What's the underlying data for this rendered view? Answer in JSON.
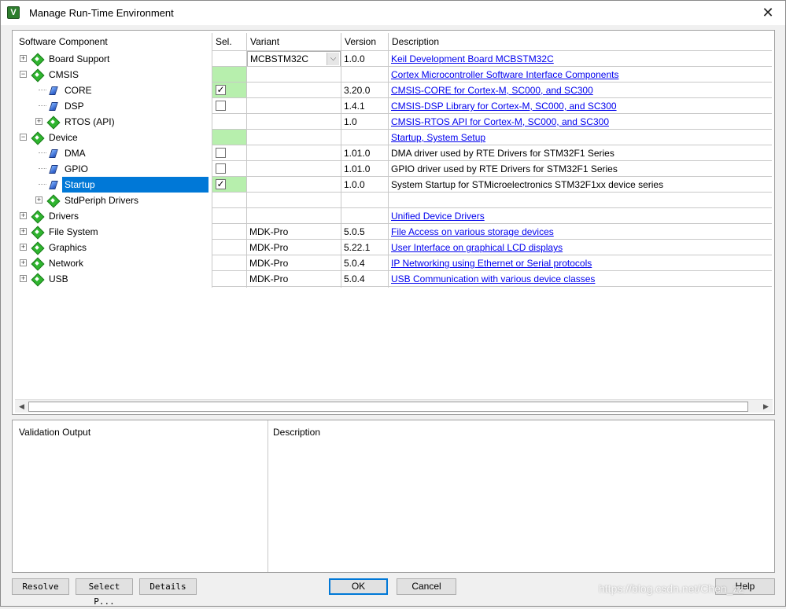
{
  "window": {
    "title": "Manage Run-Time Environment",
    "icon_letter": "V",
    "close_glyph": "✕"
  },
  "grid": {
    "headers": {
      "component": "Software Component",
      "sel": "Sel.",
      "variant": "Variant",
      "version": "Version",
      "description": "Description"
    },
    "rows": [
      {
        "name": "Board Support",
        "level": 0,
        "expander": "+",
        "icon": "component-icon",
        "sel": "",
        "sel_green": false,
        "checkbox": null,
        "variant": "MCBSTM32C",
        "variant_combo": true,
        "version": "1.0.0",
        "description": "Keil Development Board MCBSTM32C",
        "desc_link": true
      },
      {
        "name": "CMSIS",
        "level": 0,
        "expander": "−",
        "icon": "component-icon",
        "sel": "",
        "sel_green": true,
        "checkbox": null,
        "variant": "",
        "variant_combo": false,
        "version": "",
        "description": "Cortex Microcontroller Software Interface Components",
        "desc_link": true
      },
      {
        "name": "CORE",
        "level": 1,
        "expander": "",
        "icon": "gem-icon",
        "sel": "",
        "sel_green": true,
        "checkbox": true,
        "variant": "",
        "variant_combo": false,
        "version": "3.20.0",
        "description": "CMSIS-CORE for Cortex-M, SC000, and SC300",
        "desc_link": true
      },
      {
        "name": "DSP",
        "level": 1,
        "expander": "",
        "icon": "gem-icon",
        "sel": "",
        "sel_green": false,
        "checkbox": false,
        "variant": "",
        "variant_combo": false,
        "version": "1.4.1",
        "description": "CMSIS-DSP Library for Cortex-M, SC000, and SC300",
        "desc_link": true
      },
      {
        "name": "RTOS (API)",
        "level": 1,
        "expander": "+",
        "icon": "component-icon",
        "sel": "",
        "sel_green": false,
        "checkbox": null,
        "variant": "",
        "variant_combo": false,
        "version": "1.0",
        "description": "CMSIS-RTOS API for Cortex-M, SC000, and SC300",
        "desc_link": true
      },
      {
        "name": "Device",
        "level": 0,
        "expander": "−",
        "icon": "component-icon",
        "sel": "",
        "sel_green": true,
        "checkbox": null,
        "variant": "",
        "variant_combo": false,
        "version": "",
        "description": "Startup, System Setup",
        "desc_link": true
      },
      {
        "name": "DMA",
        "level": 1,
        "expander": "",
        "icon": "gem-icon",
        "sel": "",
        "sel_green": false,
        "checkbox": false,
        "variant": "",
        "variant_combo": false,
        "version": "1.01.0",
        "description": "DMA driver used by RTE Drivers for STM32F1 Series",
        "desc_link": false
      },
      {
        "name": "GPIO",
        "level": 1,
        "expander": "",
        "icon": "gem-icon",
        "sel": "",
        "sel_green": false,
        "checkbox": false,
        "variant": "",
        "variant_combo": false,
        "version": "1.01.0",
        "description": "GPIO driver used by RTE Drivers for STM32F1 Series",
        "desc_link": false
      },
      {
        "name": "Startup",
        "level": 1,
        "expander": "",
        "icon": "gem-icon",
        "sel": "",
        "sel_green": true,
        "checkbox": true,
        "variant": "",
        "variant_combo": false,
        "version": "1.0.0",
        "description": "System Startup for STMicroelectronics STM32F1xx device series",
        "desc_link": false,
        "selected": true
      },
      {
        "name": "StdPeriph Drivers",
        "level": 1,
        "expander": "+",
        "icon": "component-icon",
        "sel": "",
        "sel_green": false,
        "checkbox": null,
        "variant": "",
        "variant_combo": false,
        "version": "",
        "description": "",
        "desc_link": false
      },
      {
        "name": "Drivers",
        "level": 0,
        "expander": "+",
        "icon": "component-icon",
        "sel": "",
        "sel_green": false,
        "checkbox": null,
        "variant": "",
        "variant_combo": false,
        "version": "",
        "description": "Unified Device Drivers",
        "desc_link": true
      },
      {
        "name": "File System",
        "level": 0,
        "expander": "+",
        "icon": "component-icon",
        "sel": "",
        "sel_green": false,
        "checkbox": null,
        "variant": "MDK-Pro",
        "variant_combo": false,
        "version": "5.0.5",
        "description": "File Access on various storage devices",
        "desc_link": true
      },
      {
        "name": "Graphics",
        "level": 0,
        "expander": "+",
        "icon": "component-icon",
        "sel": "",
        "sel_green": false,
        "checkbox": null,
        "variant": "MDK-Pro",
        "variant_combo": false,
        "version": "5.22.1",
        "description": "User Interface on graphical LCD displays",
        "desc_link": true
      },
      {
        "name": "Network",
        "level": 0,
        "expander": "+",
        "icon": "component-icon",
        "sel": "",
        "sel_green": false,
        "checkbox": null,
        "variant": "MDK-Pro",
        "variant_combo": false,
        "version": "5.0.4",
        "description": "IP Networking using Ethernet or Serial protocols",
        "desc_link": true
      },
      {
        "name": "USB",
        "level": 0,
        "expander": "+",
        "icon": "component-icon",
        "sel": "",
        "sel_green": false,
        "checkbox": null,
        "variant": "MDK-Pro",
        "variant_combo": false,
        "version": "5.0.4",
        "description": "USB Communication with various device classes",
        "desc_link": true
      }
    ]
  },
  "scrollbar": {
    "left_arrow": "◀",
    "right_arrow": "▶"
  },
  "bottom": {
    "validation_label": "Validation Output",
    "description_label": "Description"
  },
  "buttons": {
    "resolve": "Resolve",
    "select_packs": "Select P...",
    "details": "Details",
    "ok": "OK",
    "cancel": "Cancel",
    "help": "Help"
  },
  "watermark": "https://blog.csdn.net/Chen_zz"
}
